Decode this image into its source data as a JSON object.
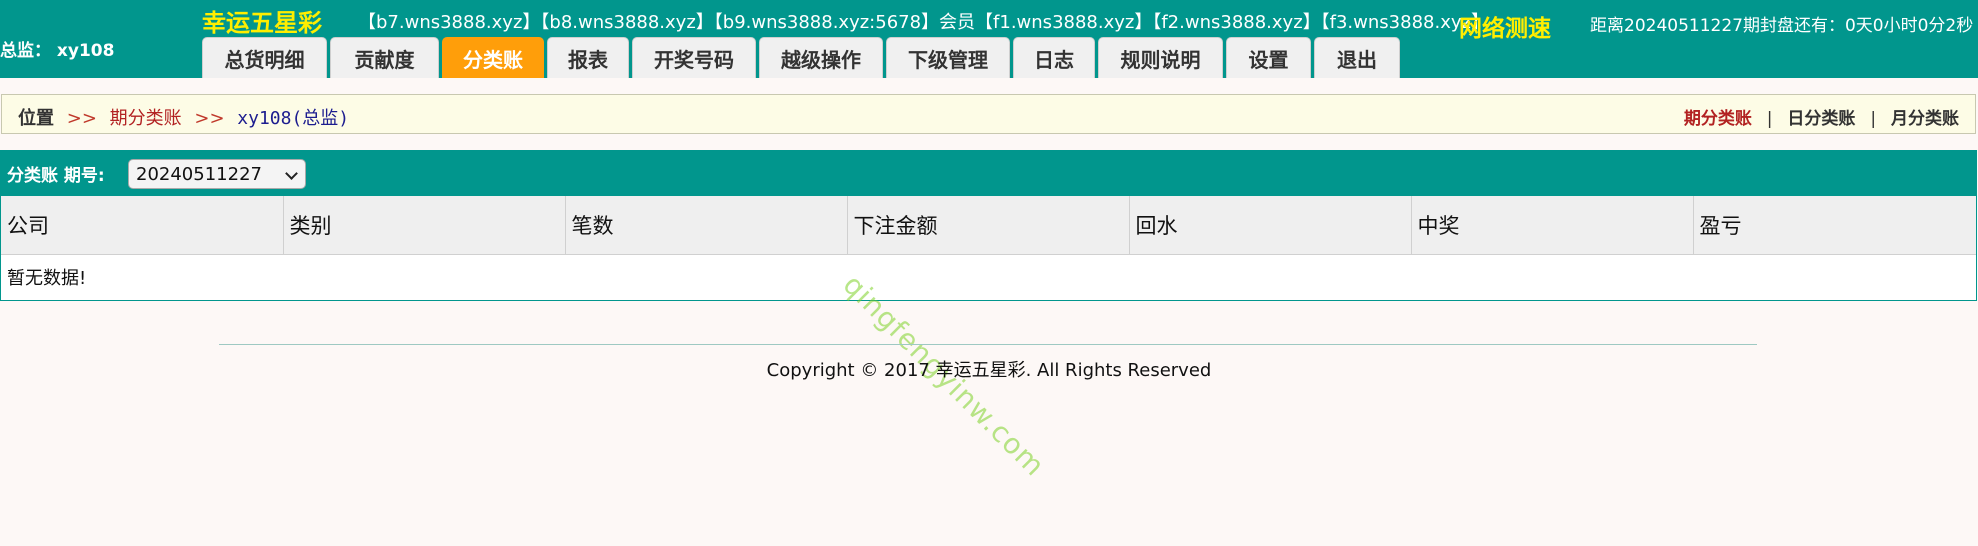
{
  "header": {
    "brand": "幸运五星彩",
    "domains": "【b7.wns3888.xyz】【b8.wns3888.xyz】【b9.wns3888.xyz:5678】会员【f1.wns3888.xyz】【f2.wns3888.xyz】【f3.wns3888.xyz】",
    "net_speed": "网络测速",
    "countdown": "距离20240511227期封盘还有：0天0小时0分2秒",
    "user_role": "总监：",
    "user_name": "xy108",
    "colors": {
      "bar": "#01968d",
      "accent": "#ffee00",
      "active_tab": "#ff9e0a"
    }
  },
  "nav": {
    "tabs": [
      {
        "label": "总货明细"
      },
      {
        "label": "贡献度"
      },
      {
        "label": "分类账",
        "active": true
      },
      {
        "label": "报表"
      },
      {
        "label": "开奖号码"
      },
      {
        "label": "越级操作"
      },
      {
        "label": "下级管理"
      },
      {
        "label": "日志"
      },
      {
        "label": "规则说明"
      },
      {
        "label": "设置"
      },
      {
        "label": "退出"
      }
    ]
  },
  "breadcrumb": {
    "label": "位置",
    "sep": ">>",
    "page": "期分类账",
    "account": "xy108",
    "account_role": "(总监)"
  },
  "views": {
    "period": "期分类账",
    "day": "日分类账",
    "month": "月分类账",
    "separator": "|"
  },
  "ledger": {
    "title": "分类账 期号:",
    "period_value": "20240511227",
    "columns": [
      "公司",
      "类别",
      "笔数",
      "下注金额",
      "回水",
      "中奖",
      "盈亏"
    ],
    "empty_message": "暂无数据!"
  },
  "watermark": "qingfengyinw.com",
  "footer": {
    "copyright": "Copyright © 2017 幸运五星彩. All Rights Reserved"
  }
}
